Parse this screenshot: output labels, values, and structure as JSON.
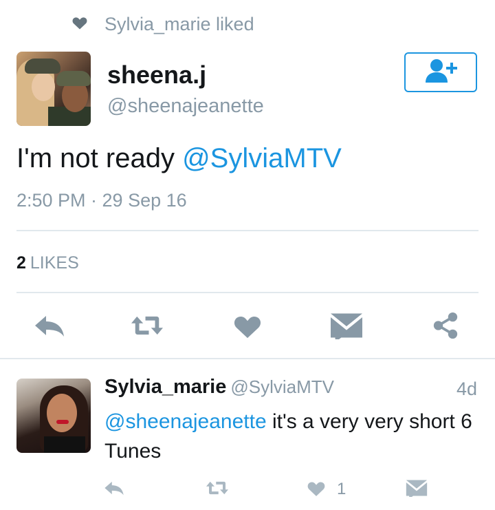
{
  "context": {
    "liked_by": "Sylvia_marie liked"
  },
  "tweet": {
    "display_name": "sheena.j",
    "handle": "@sheenajeanette",
    "text_prefix": "I'm not ready ",
    "mention": "@SylviaMTV",
    "timestamp": "2:50 PM · 29 Sep 16",
    "likes_count": "2",
    "likes_label": "LIKES",
    "icons": {
      "follow": "follow-user-icon",
      "reply": "reply-icon",
      "retweet": "retweet-icon",
      "like": "heart-icon",
      "dm": "envelope-icon",
      "share": "share-icon"
    }
  },
  "reply": {
    "display_name": "Sylvia_marie",
    "handle": "@SylviaMTV",
    "time": "4d",
    "mention": "@sheenajeanette",
    "text": " it's a very very short 6 Tunes",
    "like_count": "1"
  },
  "colors": {
    "accent": "#1b95e0",
    "icon_grey": "#8899a6",
    "icon_light": "#aab8c2",
    "divider": "#e1e8ed",
    "text": "#14171a"
  }
}
